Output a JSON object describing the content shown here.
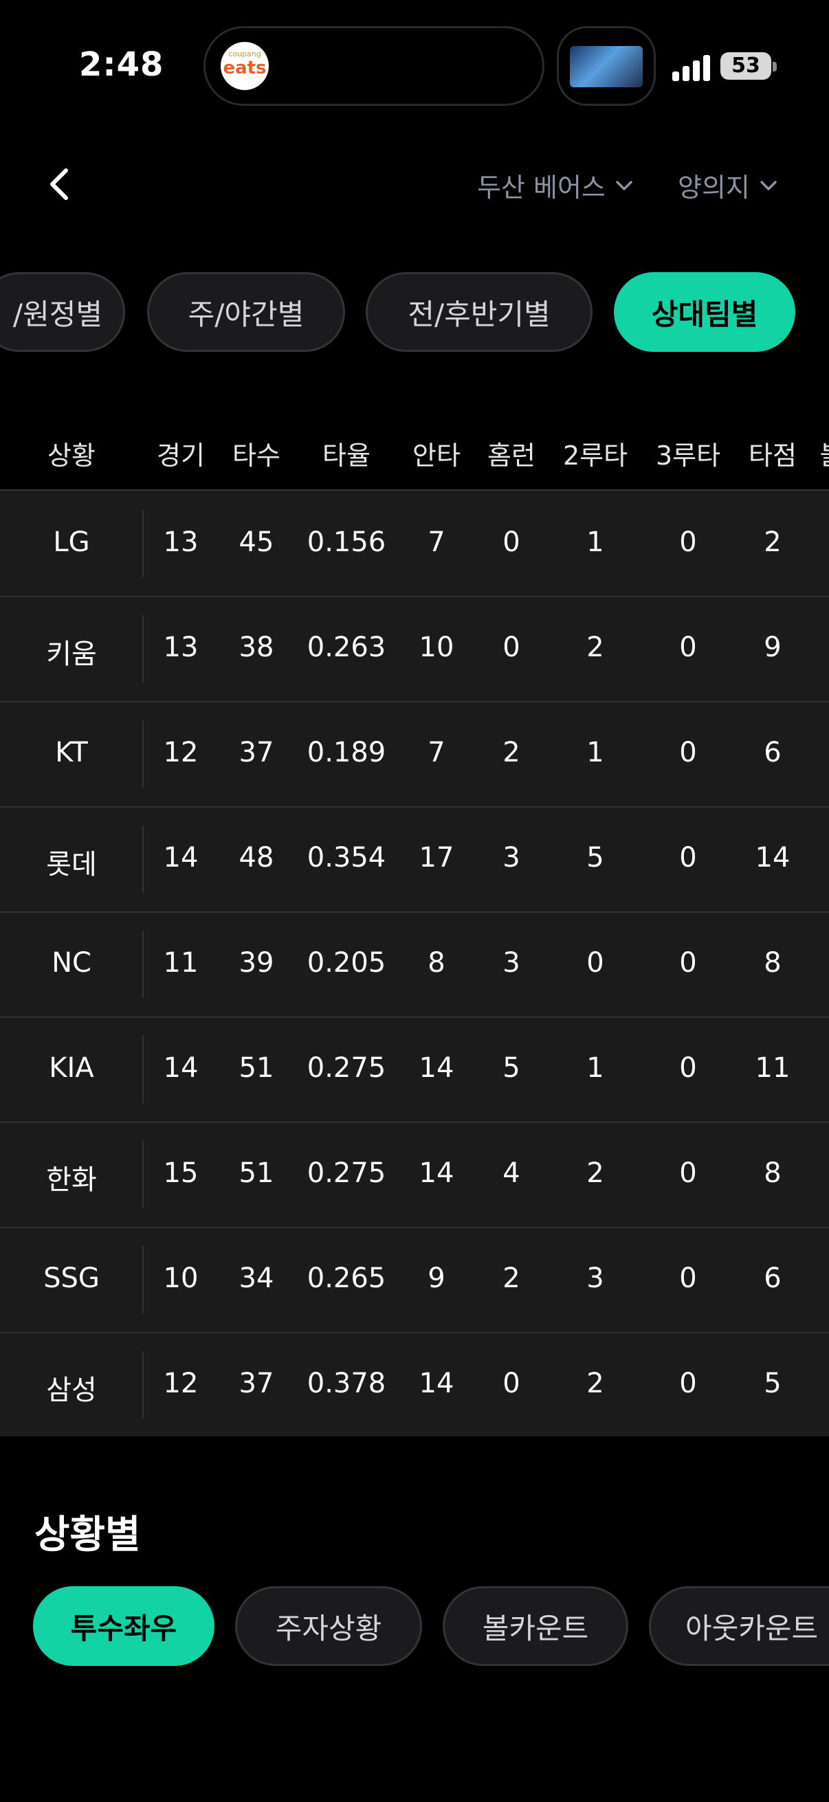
{
  "status_bar": {
    "time": "2:48",
    "battery": "53",
    "island_logo_top": "coupang",
    "island_logo_main": "eats"
  },
  "header": {
    "team_filter": "두산 베어스",
    "player_filter": "양의지"
  },
  "split_tabs": [
    {
      "label": "/원정별",
      "active": false
    },
    {
      "label": "주/야간별",
      "active": false
    },
    {
      "label": "전/후반기별",
      "active": false
    },
    {
      "label": "상대팀별",
      "active": true
    }
  ],
  "table": {
    "columns": [
      "상황",
      "경기",
      "타수",
      "타율",
      "안타",
      "홈런",
      "2루타",
      "3루타",
      "타점",
      "볼"
    ],
    "rows": [
      [
        "LG",
        "13",
        "45",
        "0.156",
        "7",
        "0",
        "1",
        "0",
        "2"
      ],
      [
        "키움",
        "13",
        "38",
        "0.263",
        "10",
        "0",
        "2",
        "0",
        "9"
      ],
      [
        "KT",
        "12",
        "37",
        "0.189",
        "7",
        "2",
        "1",
        "0",
        "6"
      ],
      [
        "롯데",
        "14",
        "48",
        "0.354",
        "17",
        "3",
        "5",
        "0",
        "14"
      ],
      [
        "NC",
        "11",
        "39",
        "0.205",
        "8",
        "3",
        "0",
        "0",
        "8"
      ],
      [
        "KIA",
        "14",
        "51",
        "0.275",
        "14",
        "5",
        "1",
        "0",
        "11"
      ],
      [
        "한화",
        "15",
        "51",
        "0.275",
        "14",
        "4",
        "2",
        "0",
        "8"
      ],
      [
        "SSG",
        "10",
        "34",
        "0.265",
        "9",
        "2",
        "3",
        "0",
        "6"
      ],
      [
        "삼성",
        "12",
        "37",
        "0.378",
        "14",
        "0",
        "2",
        "0",
        "5"
      ]
    ]
  },
  "situation_section": {
    "title": "상황별",
    "tabs": [
      {
        "label": "투수좌우",
        "active": true
      },
      {
        "label": "주자상황",
        "active": false
      },
      {
        "label": "볼카운트",
        "active": false
      },
      {
        "label": "아웃카운트",
        "active": false
      }
    ]
  },
  "colors": {
    "accent": "#13d3a4",
    "background": "#000000",
    "table_bg": "#1b1b1b",
    "filter_text": "#8c93a3"
  }
}
